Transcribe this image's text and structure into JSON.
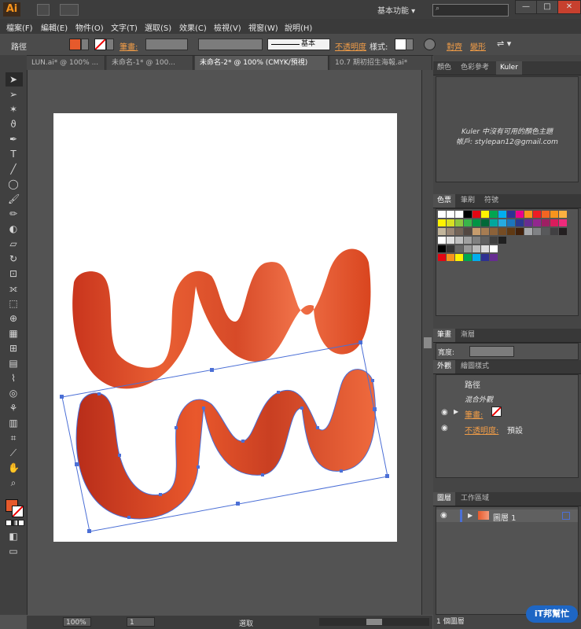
{
  "app": {
    "logo": "Ai",
    "workspace": "基本功能 ▾"
  },
  "window_controls": [
    "—",
    "□",
    "✕"
  ],
  "menu": [
    "檔案(F)",
    "編輯(E)",
    "物件(O)",
    "文字(T)",
    "選取(S)",
    "效果(C)",
    "檢視(V)",
    "視窗(W)",
    "說明(H)"
  ],
  "control": {
    "object_type": "路徑",
    "stroke_label": "筆畫:",
    "stroke_style": "基本",
    "opacity_label": "不透明度",
    "style_label": "樣式:",
    "align_label": "對齊",
    "transform_label": "變形"
  },
  "doc_tabs": [
    "LUN.ai* @ 100% ...",
    "未命名-1* @ 100...",
    "未命名-2* @ 100% (CMYK/預視)",
    "10.7 期初招生海報.ai*"
  ],
  "kuler": {
    "tabs": [
      "顏色",
      "色彩參考",
      "Kuler"
    ],
    "message": "Kuler 中沒有可用的顏色主題",
    "account": "帳戶: stylepan12@gmail.com"
  },
  "swatches_panel": {
    "tabs": [
      "色票",
      "筆刷",
      "符號"
    ]
  },
  "stroke_panel": {
    "tabs": [
      "筆畫",
      "漸層"
    ],
    "weight_label": "寬度:"
  },
  "appearance_panel": {
    "tabs": [
      "外觀",
      "繪圖樣式"
    ],
    "title": "路徑",
    "subtitle": "混合外觀",
    "stroke_label": "筆畫:",
    "opacity_label": "不透明度:",
    "opacity_value": "預設"
  },
  "layers_panel": {
    "tabs": [
      "圖層",
      "工作區域"
    ],
    "layer_name": "圖層 1",
    "footer": "1 個圖層"
  },
  "status": {
    "zoom": "100%",
    "page": "1",
    "tool": "選取"
  },
  "artwork": {
    "text_top": "LUN",
    "text_bottom": "LUN"
  },
  "watermark": "iT邦幫忙",
  "colors": {
    "accent_orange": "#e65a2c",
    "selection_blue": "#4b6fd6",
    "label_orange": "#f09c47"
  }
}
